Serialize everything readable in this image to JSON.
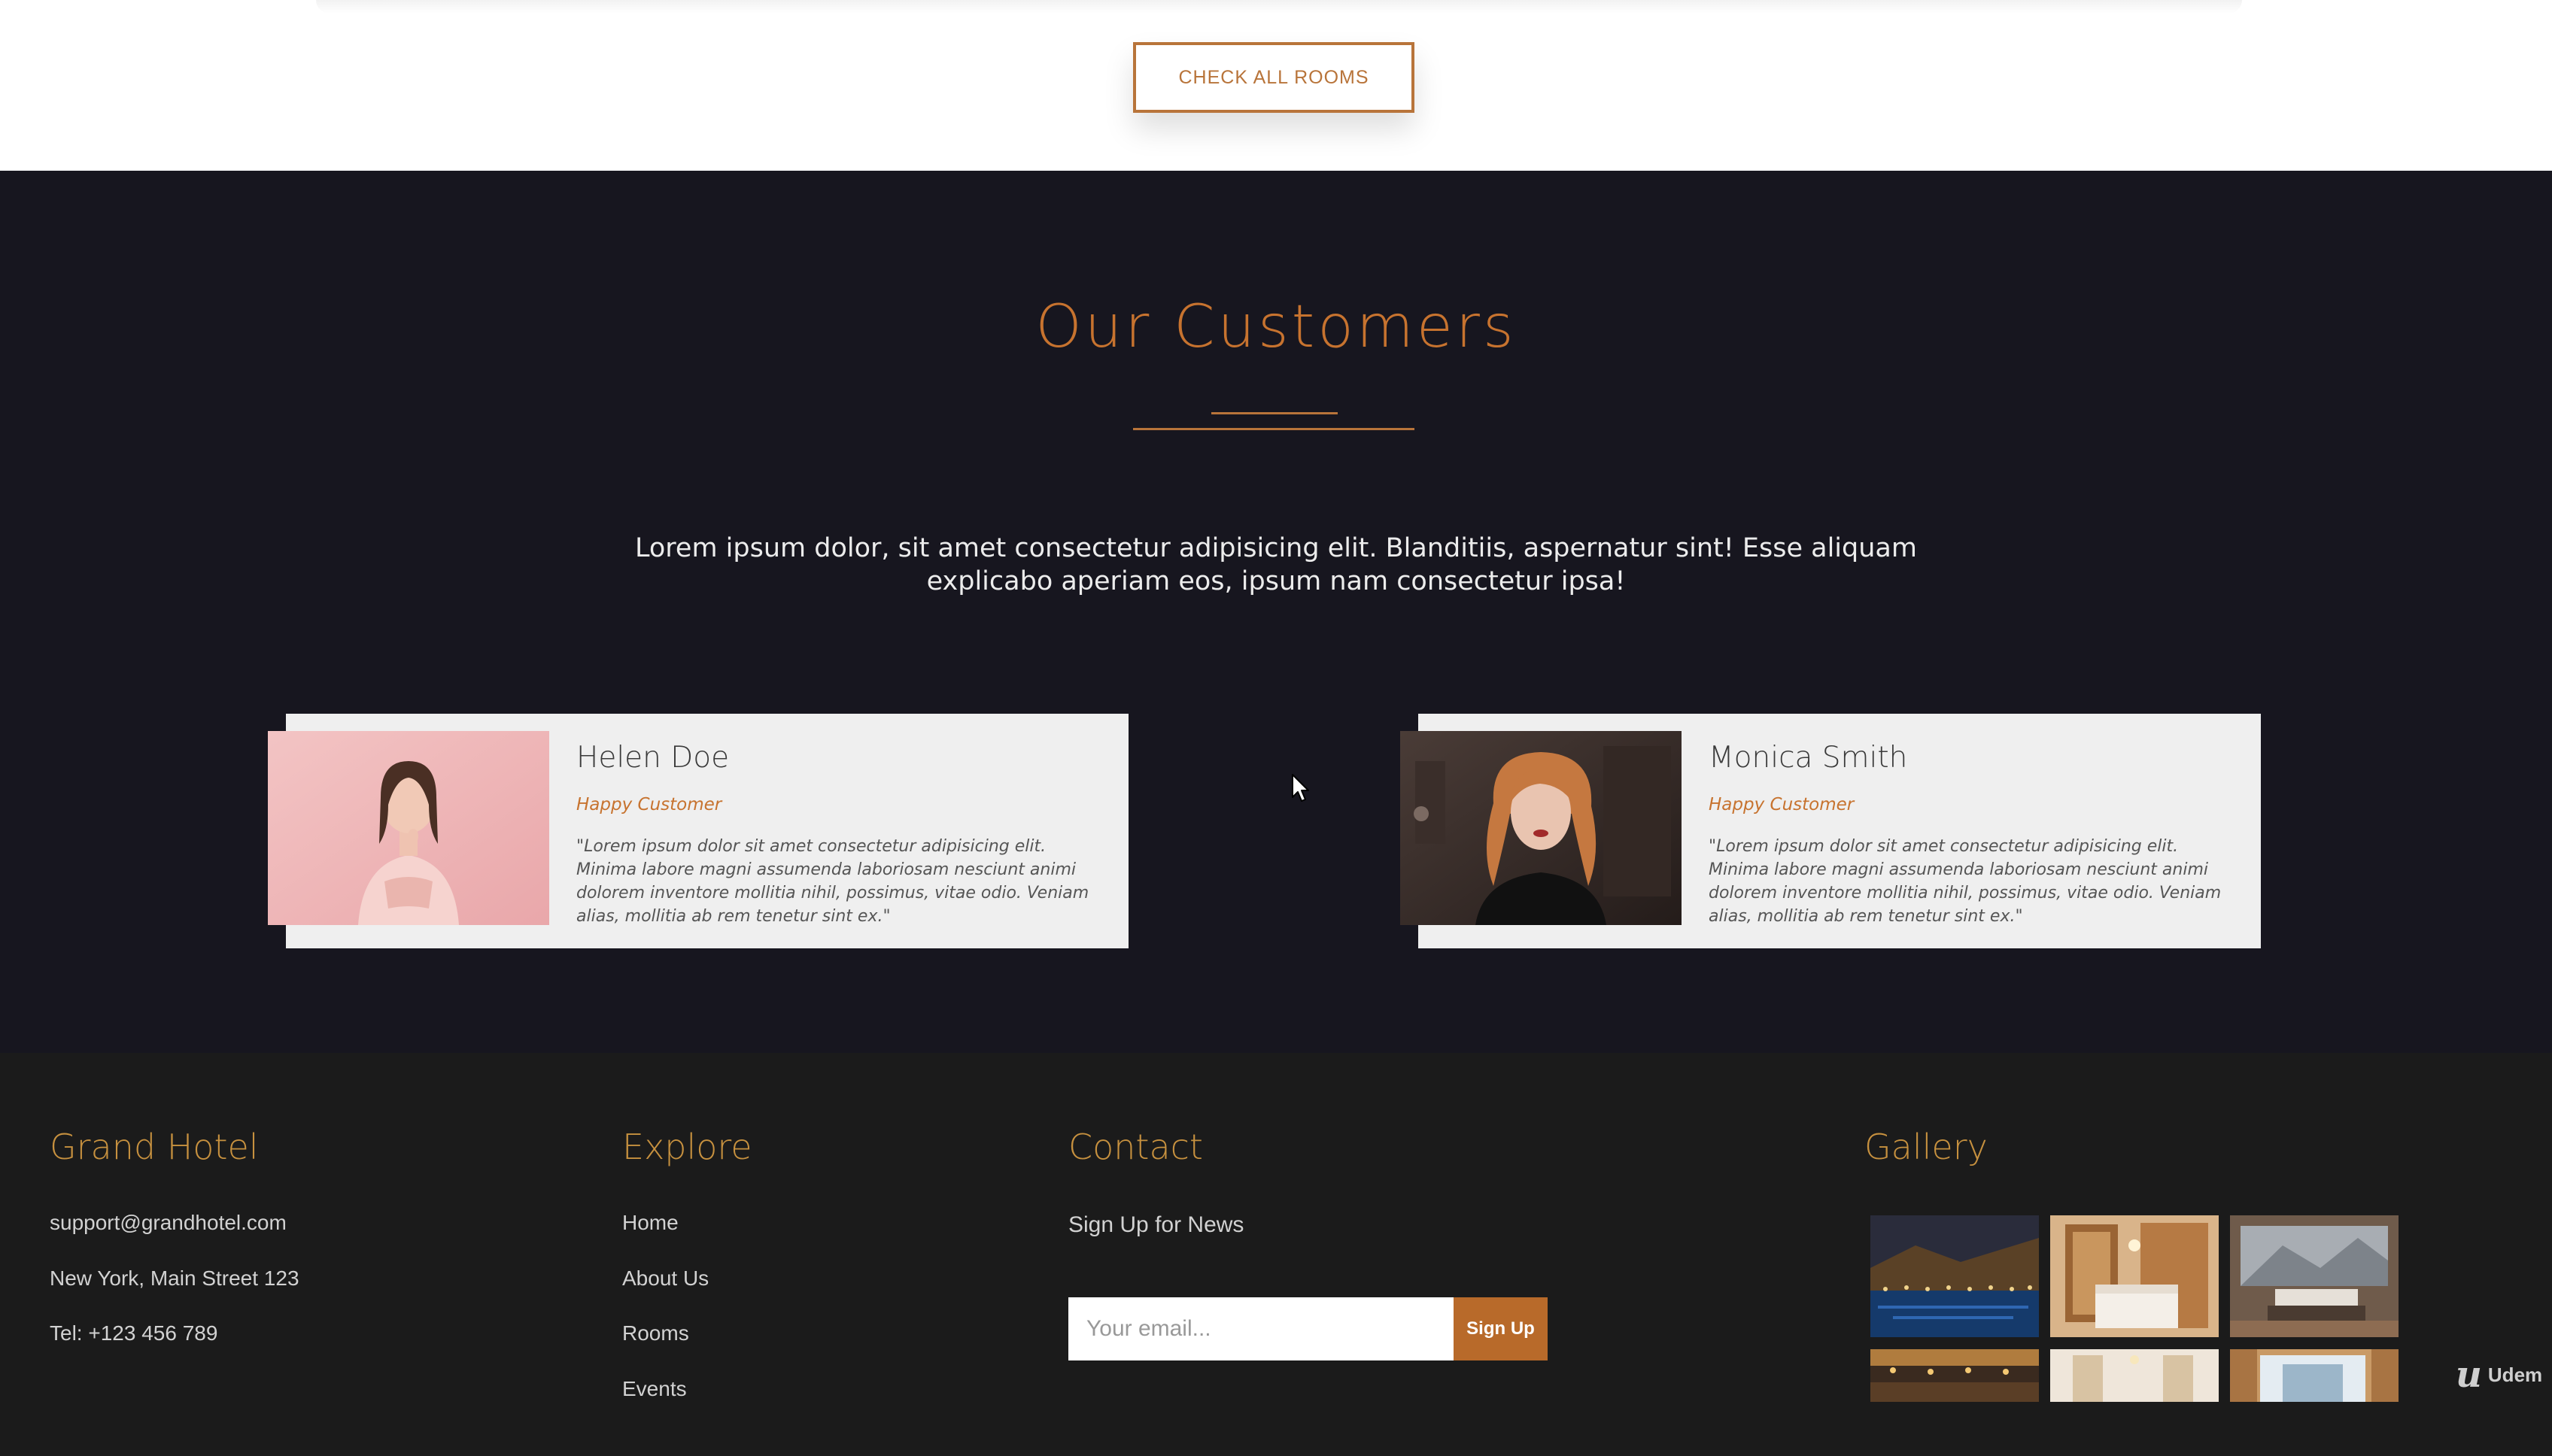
{
  "rooms_button": {
    "label": "CHECK ALL ROOMS"
  },
  "customers": {
    "title": "Our Customers",
    "intro": "Lorem ipsum dolor, sit amet consectetur adipisicing elit. Blanditiis, aspernatur sint! Esse aliquam explicabo aperiam eos, ipsum nam consectetur ipsa!",
    "items": [
      {
        "name": "Helen Doe",
        "role": "Happy Customer",
        "quote": "\"Lorem ipsum dolor sit amet consectetur adipisicing elit. Minima labore magni assumenda laboriosam nesciunt animi dolorem inventore mollitia nihil, possimus, vitae odio. Veniam alias, mollitia ab rem tenetur sint ex.\""
      },
      {
        "name": "Monica Smith",
        "role": "Happy Customer",
        "quote": "\"Lorem ipsum dolor sit amet consectetur adipisicing elit. Minima labore magni assumenda laboriosam nesciunt animi dolorem inventore mollitia nihil, possimus, vitae odio. Veniam alias, mollitia ab rem tenetur sint ex.\""
      }
    ]
  },
  "footer": {
    "hotel": {
      "heading": "Grand Hotel",
      "email": "support@grandhotel.com",
      "address": "New York, Main Street 123",
      "phone": "Tel: +123 456 789"
    },
    "explore": {
      "heading": "Explore",
      "links": [
        "Home",
        "About Us",
        "Rooms",
        "Events"
      ]
    },
    "contact": {
      "heading": "Contact",
      "subheading": "Sign Up for News",
      "email_placeholder": "Your email...",
      "signup_label": "Sign Up"
    },
    "gallery": {
      "heading": "Gallery"
    }
  },
  "watermark": {
    "text": "Udem"
  },
  "colors": {
    "accent": "#c7732f",
    "dark_section": "#17161f",
    "footer": "#1b1b1b",
    "card": "#efefef"
  }
}
